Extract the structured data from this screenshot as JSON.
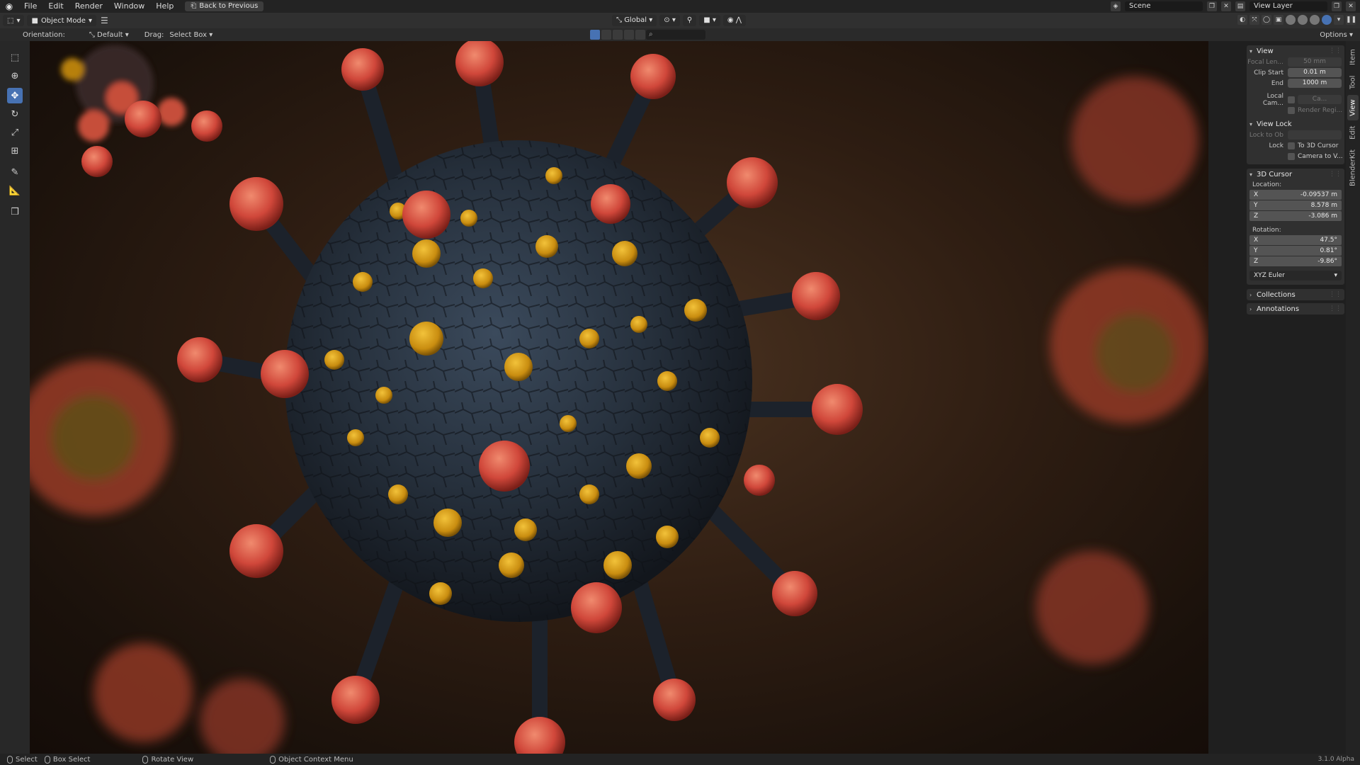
{
  "menu": {
    "items": [
      "File",
      "Edit",
      "Render",
      "Window",
      "Help"
    ],
    "back_button": "Back to Previous",
    "scene": "Scene",
    "view_layer": "View Layer"
  },
  "header": {
    "mode": "Object Mode",
    "transform_orientation": "Global",
    "options": "Options"
  },
  "tool_settings": {
    "orientation_label": "Orientation:",
    "orientation_value": "Default",
    "drag_label": "Drag:",
    "drag_value": "Select Box"
  },
  "toolbar": {
    "tools": [
      "select-box",
      "cursor",
      "move",
      "rotate",
      "scale",
      "transform",
      "annotate",
      "measure",
      "add-cube"
    ],
    "active_tool": "move"
  },
  "npanel": {
    "view_section": "View",
    "focal_length_label": "Focal Len...",
    "focal_length_value": "50 mm",
    "clip_start_label": "Clip Start",
    "clip_start_value": "0.01 m",
    "clip_end_label": "End",
    "clip_end_value": "1000 m",
    "local_camera_label": "Local Cam...",
    "local_camera_value": "Ca...",
    "render_region": "Render Regi...",
    "view_lock_section": "View Lock",
    "lock_to_object_label": "Lock to Ob",
    "lock_label": "Lock",
    "to_3d_cursor": "To 3D Cursor",
    "camera_to_view": "Camera to V...",
    "cursor_section": "3D Cursor",
    "location_label": "Location:",
    "location": {
      "x_label": "X",
      "x": "-0.09537 m",
      "y_label": "Y",
      "y": "8.578 m",
      "z_label": "Z",
      "z": "-3.086 m"
    },
    "rotation_label": "Rotation:",
    "rotation": {
      "x_label": "X",
      "x": "47.5°",
      "y_label": "Y",
      "y": "0.81°",
      "z_label": "Z",
      "z": "-9.86°"
    },
    "rotation_mode": "XYZ Euler",
    "collections_section": "Collections",
    "annotations_section": "Annotations"
  },
  "vtabs": [
    "Item",
    "Tool",
    "View",
    "Edit",
    "BlenderKit"
  ],
  "active_vtab": "View",
  "statusbar": {
    "select": "Select",
    "box_select": "Box Select",
    "rotate_view": "Rotate View",
    "context_menu": "Object Context Menu",
    "version": "3.1.0 Alpha"
  },
  "colors": {
    "accent": "#4772b3",
    "virus_body": "#2b3340",
    "spike_red": "#d9553f",
    "spike_yellow": "#d9a21a",
    "background": "#2e1d12"
  }
}
